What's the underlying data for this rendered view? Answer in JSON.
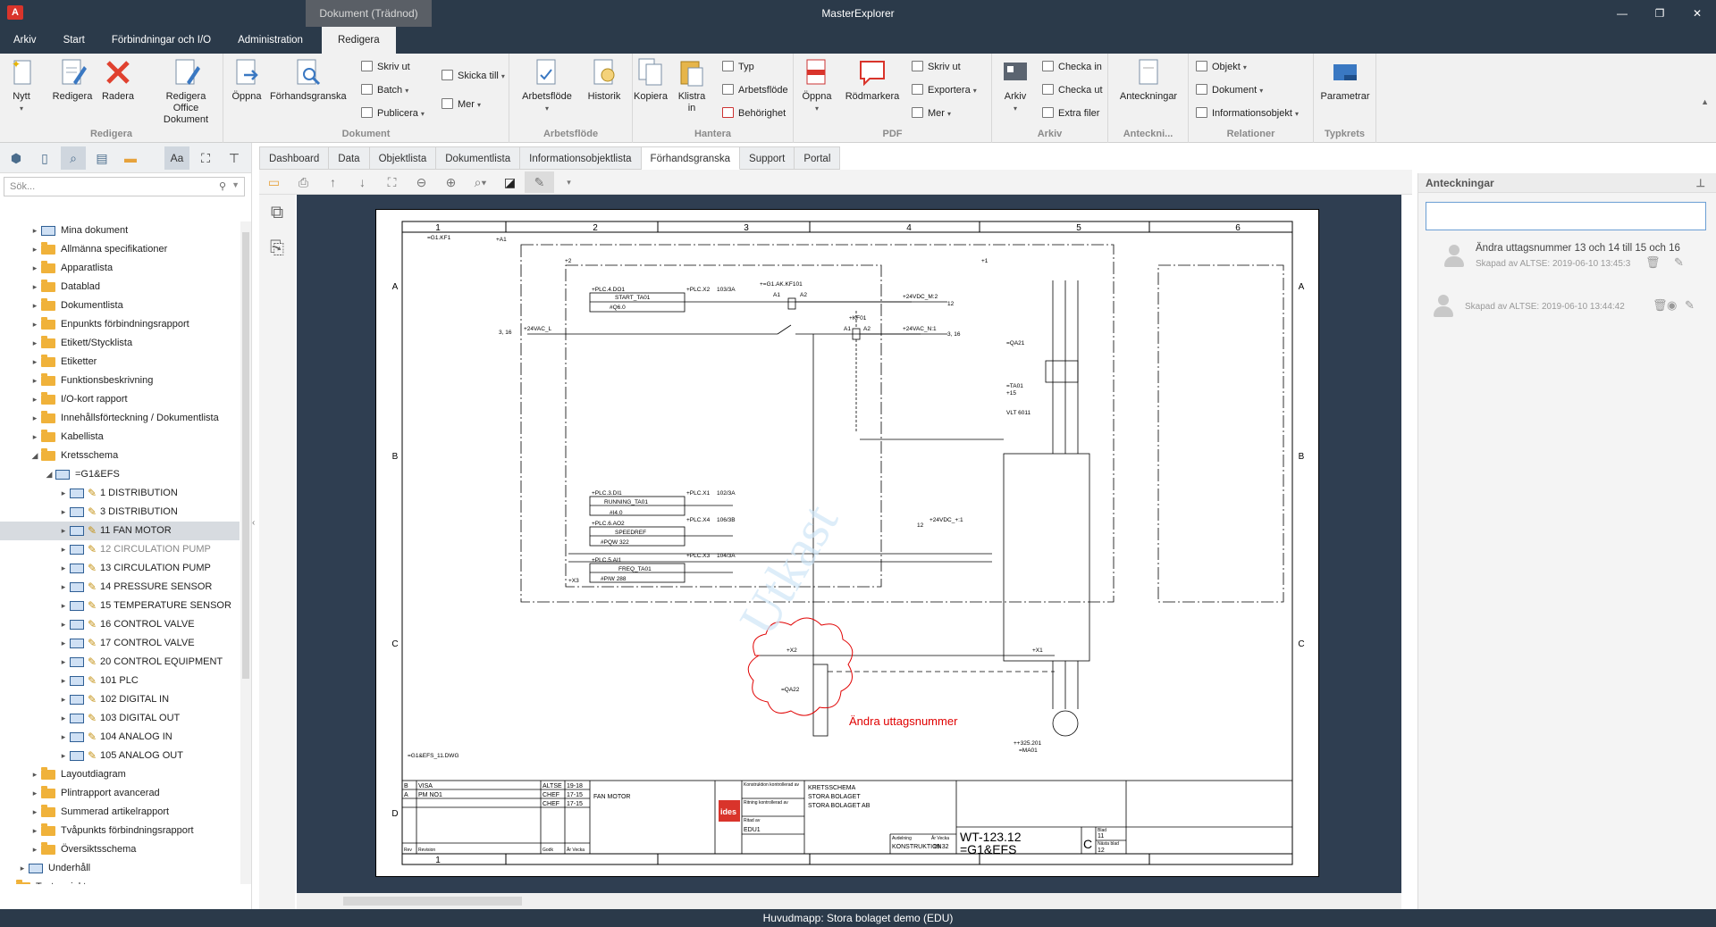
{
  "app": {
    "title": "MasterExplorer",
    "context_tab": "Dokument (Trädnod)",
    "logo": "A"
  },
  "window": {
    "minimize": "—",
    "restore": "❐",
    "close": "✕"
  },
  "menu": [
    "Arkiv",
    "Start",
    "Förbindningar och I/O",
    "Administration",
    "Redigera"
  ],
  "ribbon": {
    "g1": {
      "label": "Redigera",
      "nytt": "Nytt",
      "redigera": "Redigera",
      "radera": "Radera",
      "office": "Redigera Office",
      "office2": "Dokument"
    },
    "g2": {
      "label": "Dokument",
      "oppna": "Öppna",
      "forhand": "Förhandsgranska",
      "skriv": "Skriv ut",
      "batch": "Batch",
      "publicera": "Publicera",
      "skicka": "Skicka till",
      "mer": "Mer"
    },
    "g3": {
      "label": "Arbetsflöde",
      "arbetsflode": "Arbetsflöde",
      "historik": "Historik",
      "typ": "Typ",
      "arbetsflode2": "Arbetsflöde",
      "behorighet": "Behörighet"
    },
    "g4": {
      "label": "Hantera",
      "kopiera": "Kopiera",
      "klistra": "Klistra",
      "klistra2": "in"
    },
    "g5": {
      "label": "PDF",
      "oppna": "Öppna",
      "rod": "Rödmarkera",
      "skriv": "Skriv ut",
      "exportera": "Exportera",
      "mer": "Mer"
    },
    "g6": {
      "label": "Arkiv",
      "arkiv": "Arkiv",
      "checkain": "Checka in",
      "checkaut": "Checka ut",
      "extra": "Extra filer"
    },
    "g7": {
      "label": "Anteckni...",
      "anteck": "Anteckningar"
    },
    "g8": {
      "label": "Relationer",
      "objekt": "Objekt",
      "dokument": "Dokument",
      "info": "Informationsobjekt"
    },
    "g9": {
      "label": "Typkrets",
      "param": "Parametrar"
    }
  },
  "search": {
    "placeholder": "Sök..."
  },
  "tree": [
    {
      "label": "Mina dokument",
      "lvl": 0,
      "icon": "doc"
    },
    {
      "label": "Allmänna specifikationer",
      "lvl": 0,
      "icon": "folder"
    },
    {
      "label": "Apparatlista",
      "lvl": 0,
      "icon": "folder"
    },
    {
      "label": "Datablad",
      "lvl": 0,
      "icon": "folder"
    },
    {
      "label": "Dokumentlista",
      "lvl": 0,
      "icon": "folder"
    },
    {
      "label": "Enpunkts förbindningsrapport",
      "lvl": 0,
      "icon": "folder"
    },
    {
      "label": "Etikett/Stycklista",
      "lvl": 0,
      "icon": "folder"
    },
    {
      "label": "Etiketter",
      "lvl": 0,
      "icon": "folder"
    },
    {
      "label": "Funktionsbeskrivning",
      "lvl": 0,
      "icon": "folder"
    },
    {
      "label": "I/O-kort rapport",
      "lvl": 0,
      "icon": "folder"
    },
    {
      "label": "Innehållsförteckning / Dokumentlista",
      "lvl": 0,
      "icon": "folder"
    },
    {
      "label": "Kabellista",
      "lvl": 0,
      "icon": "folder"
    },
    {
      "label": "Kretsschema",
      "lvl": 0,
      "icon": "folder",
      "open": true
    },
    {
      "label": "=G1&EFS",
      "lvl": 1,
      "icon": "dwg",
      "open": true
    },
    {
      "label": "1   DISTRIBUTION",
      "lvl": 2,
      "icon": "sheet"
    },
    {
      "label": "3   DISTRIBUTION",
      "lvl": 2,
      "icon": "sheet"
    },
    {
      "label": "11   FAN MOTOR",
      "lvl": 2,
      "icon": "sheet",
      "sel": true
    },
    {
      "label": "12   CIRCULATION PUMP",
      "lvl": 2,
      "icon": "sheet",
      "gray": true
    },
    {
      "label": "13   CIRCULATION PUMP",
      "lvl": 2,
      "icon": "sheet"
    },
    {
      "label": "14   PRESSURE SENSOR",
      "lvl": 2,
      "icon": "sheet"
    },
    {
      "label": "15   TEMPERATURE SENSOR",
      "lvl": 2,
      "icon": "sheet"
    },
    {
      "label": "16   CONTROL VALVE",
      "lvl": 2,
      "icon": "sheet"
    },
    {
      "label": "17   CONTROL VALVE",
      "lvl": 2,
      "icon": "sheet"
    },
    {
      "label": "20   CONTROL EQUIPMENT",
      "lvl": 2,
      "icon": "sheet"
    },
    {
      "label": "101   PLC",
      "lvl": 2,
      "icon": "sheet"
    },
    {
      "label": "102   DIGITAL IN",
      "lvl": 2,
      "icon": "sheet"
    },
    {
      "label": "103   DIGITAL OUT",
      "lvl": 2,
      "icon": "sheet"
    },
    {
      "label": "104   ANALOG IN",
      "lvl": 2,
      "icon": "sheet"
    },
    {
      "label": "105   ANALOG OUT",
      "lvl": 2,
      "icon": "sheet"
    },
    {
      "label": "Layoutdiagram",
      "lvl": 0,
      "icon": "folder"
    },
    {
      "label": "Plintrapport avancerad",
      "lvl": 0,
      "icon": "folder"
    },
    {
      "label": "Summerad artikelrapport",
      "lvl": 0,
      "icon": "folder"
    },
    {
      "label": "Tvåpunkts förbindningsrapport",
      "lvl": 0,
      "icon": "folder"
    },
    {
      "label": "Översiktsschema",
      "lvl": 0,
      "icon": "folder"
    },
    {
      "label": "Underhåll",
      "lvl": -1,
      "icon": "dwg"
    },
    {
      "label": "Test projekt",
      "lvl": -2,
      "icon": "folder"
    }
  ],
  "tabs": [
    "Dashboard",
    "Data",
    "Objektlista",
    "Dokumentlista",
    "Informationsobjektlista",
    "Förhandsgranska",
    "Support",
    "Portal"
  ],
  "active_tab": "Förhandsgranska",
  "annotations": {
    "title": "Anteckningar",
    "items": [
      {
        "text": "Ändra uttagsnummer 13 och 14 till 15 och 16",
        "meta": "Skapad av   ALTSE: 2019-06-10 13:45:3"
      },
      {
        "text": "",
        "meta": "Skapad av   ALTSE: 2019-06-10 13:44:42"
      }
    ]
  },
  "drawing": {
    "col_labels": [
      "1",
      "2",
      "3",
      "4",
      "5",
      "6"
    ],
    "row_labels": [
      "A",
      "B",
      "C",
      "D"
    ],
    "title_block": {
      "title": "KRETSSCHEMA",
      "company1": "STORA BOLAGET",
      "company2": "STORA BOLAGET AB",
      "desc": "FAN MOTOR",
      "docno": "WT-123.12",
      "ref": "=G1&EFS",
      "rev": "C",
      "sheet": "11",
      "next": "12",
      "logo": "ides",
      "dept": "KONSTRUKTION",
      "edu": "EDU1",
      "rev_b": "B",
      "rev_a": "A",
      "visa": "VISA",
      "pm": "PM NO1",
      "r1": "ALTSE",
      "r2": "CHEF",
      "r3": "CHEF",
      "d1": "19-18",
      "d2": "17-15",
      "d3": "17-15",
      "lbl_rev": "Rev",
      "lbl_revision": "Revision",
      "lbl_godk": "Godk",
      "lbl_vecka": "År Vecka",
      "lbl_kk": "Konstruktion kontrollerad av",
      "lbl_rk": "Ritning kontrollerad av",
      "lbl_rit": "Ritad av",
      "lbl_avd": "Avdelning",
      "lbl_ar": "År Vecka",
      "lbl_blad": "Blad",
      "lbl_nasta": "Nästa blad",
      "vecka": "19.32"
    },
    "redline": "Ändra uttagsnummer",
    "watermark": "Utkast"
  },
  "status": "Huvudmapp: Stora bolaget demo (EDU)"
}
